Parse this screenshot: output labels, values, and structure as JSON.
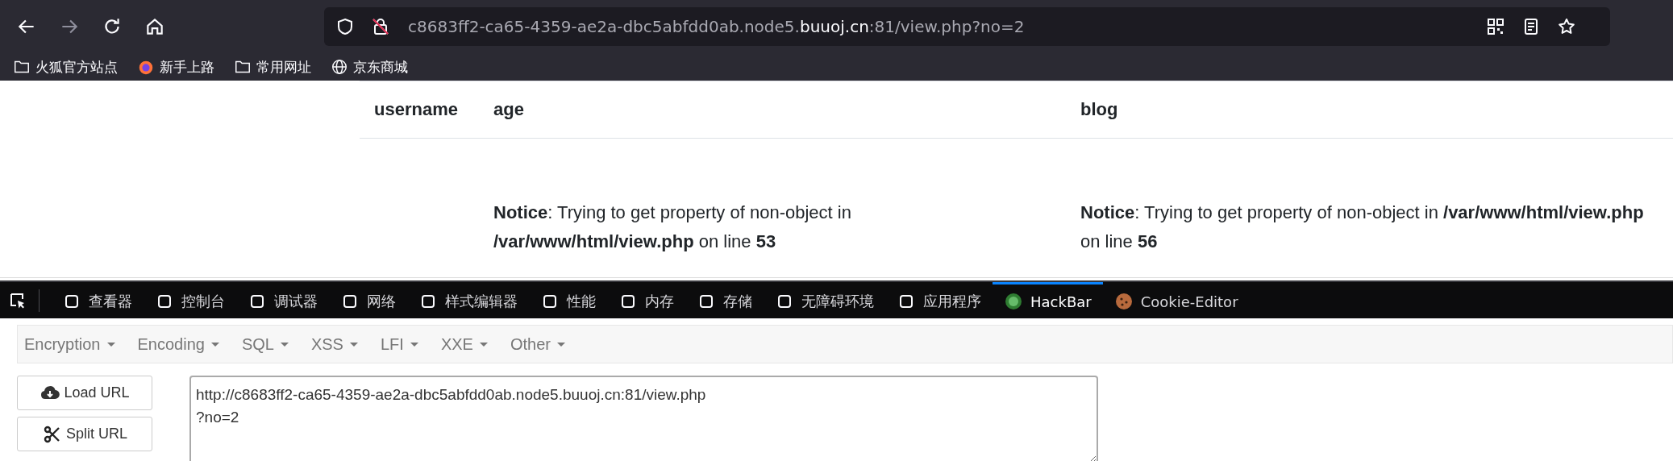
{
  "address_bar": {
    "url_parts": [
      {
        "text": "c8683ff2-ca65-4359-ae2a-dbc5abfdd0ab.node5.",
        "emphasis": false
      },
      {
        "text": "buuoj.cn",
        "emphasis": true
      },
      {
        "text": ":81/view.php?no=2",
        "emphasis": false
      }
    ]
  },
  "bookmarks": [
    {
      "label": "火狐官方站点"
    },
    {
      "label": "新手上路"
    },
    {
      "label": "常用网址"
    },
    {
      "label": "京东商城"
    }
  ],
  "table": {
    "columns": [
      "username",
      "age",
      "blog"
    ],
    "rows": [
      [
        "",
        "**Notice**: Trying to get property of non-object in **/var/www/html/view.php** on line **53**",
        "**Notice**: Trying to get property of non-object in **/var/www/html/view.php** on line **56**"
      ]
    ]
  },
  "devtools_tabs": [
    {
      "label": "查看器",
      "selected": false
    },
    {
      "label": "控制台",
      "selected": false
    },
    {
      "label": "调试器",
      "selected": false
    },
    {
      "label": "网络",
      "selected": false
    },
    {
      "label": "样式编辑器",
      "selected": false
    },
    {
      "label": "性能",
      "selected": false
    },
    {
      "label": "内存",
      "selected": false
    },
    {
      "label": "存储",
      "selected": false
    },
    {
      "label": "无障碍环境",
      "selected": false
    },
    {
      "label": "应用程序",
      "selected": false
    },
    {
      "label": "HackBar",
      "selected": true
    },
    {
      "label": "Cookie-Editor",
      "selected": false
    }
  ],
  "hackbar": {
    "menus": [
      "Encryption",
      "Encoding",
      "SQL",
      "XSS",
      "LFI",
      "XXE",
      "Other"
    ],
    "buttons": [
      {
        "label": "Load URL",
        "kind": "load"
      },
      {
        "label": "Split URL",
        "kind": "split"
      }
    ],
    "url_value": "http://c8683ff2-ca65-4359-ae2a-dbc5abfdd0ab.node5.buuoj.cn:81/view.php\n?no=2"
  }
}
